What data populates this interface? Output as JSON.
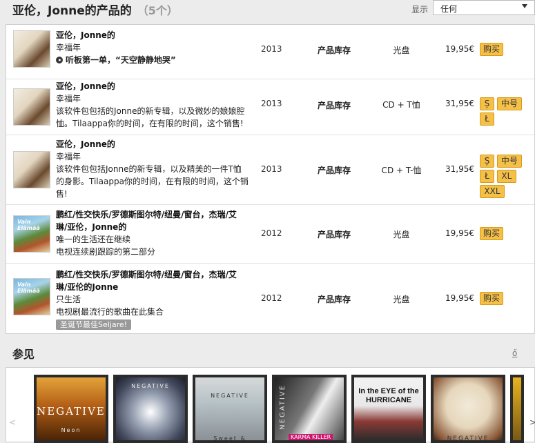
{
  "header": {
    "title": "亚伦，Jonne的产品的",
    "count": "（5个）",
    "show_label": "显示",
    "select_value": "任何"
  },
  "products": [
    {
      "artist": "亚伦，Jonne的",
      "album": "幸福年",
      "listen": "听板第一单，“天空静静地哭”",
      "year": "2013",
      "stock": "产品库存",
      "format": "光盘",
      "price": "19,95€",
      "buttons": [
        "购买"
      ]
    },
    {
      "artist": "亚伦，Jonne的",
      "album": "幸福年",
      "desc_line1": "该软件包包括的Jonne的新专辑，以及微妙的娘娘腔",
      "desc_line2": "恤。Tilaappa你的时间，在有限的时间，这个销售!",
      "year": "2013",
      "stock": "产品库存",
      "format": "CD + T恤",
      "price": "31,95€",
      "buttons": [
        "Ș",
        "中号",
        "Ł"
      ]
    },
    {
      "artist": "亚伦，Jonne的",
      "album": "幸福年",
      "desc_line1": "该软件包包括Jonne的新专辑，以及精美的一件T恤",
      "desc_line2": "的身影。Tilaappa你的时间，在有限的时间，这个销",
      "desc_line3": "售!",
      "year": "2013",
      "stock": "产品库存",
      "format": "CD + T-恤",
      "price": "31,95€",
      "buttons": [
        "Ș",
        "中号",
        "Ł",
        "XL",
        "XXL"
      ]
    },
    {
      "artist_line1": "鹏红/性交快乐/罗德斯图尔特/纽曼/窗台，杰瑞/艾",
      "artist_line2": "琳/亚伦，Jonne的",
      "album": "唯一的生活还在继续",
      "desc_line1": "电视连续剧跟踪的第二部分",
      "cover_text": "Vain Elämää",
      "year": "2012",
      "stock": "产品库存",
      "format": "光盘",
      "price": "19,95€",
      "buttons": [
        "购买"
      ]
    },
    {
      "artist_line1": "鹏红/性交快乐/罗德斯图尔特/纽曼/窗台，杰瑞/艾",
      "artist_line2": "琳/亚伦的Jonne",
      "album": "只生活",
      "desc_line1": "电视剧最流行的歌曲在此集合",
      "badge": "圣诞节最佳Seljare!",
      "cover_text": "Vain Elämää",
      "year": "2012",
      "stock": "产品库存",
      "format": "光盘",
      "price": "19,95€",
      "buttons": [
        "购买"
      ]
    }
  ],
  "see_also": {
    "title": "参见",
    "icon_text": "ő",
    "arrow_left": "<",
    "arrow_right": ">",
    "albums": [
      {
        "label": "NEGATIVE",
        "sub": "Neon"
      },
      {
        "label": "NEGATIVE",
        "sub": ""
      },
      {
        "label": "NEGATIVE",
        "sub": "Sweet & Deceitful"
      },
      {
        "label": "NEGATIVE",
        "sub": "KARMA KILLER"
      },
      {
        "label": "In the EYE of the HURRICANE",
        "sub": ""
      },
      {
        "label": "NEGATIVE",
        "sub": ""
      }
    ]
  },
  "colors": {
    "button_bg": "#f5c048",
    "button_border": "#d89a18",
    "page_bg": "#ececec",
    "badge_bg": "#999999"
  }
}
